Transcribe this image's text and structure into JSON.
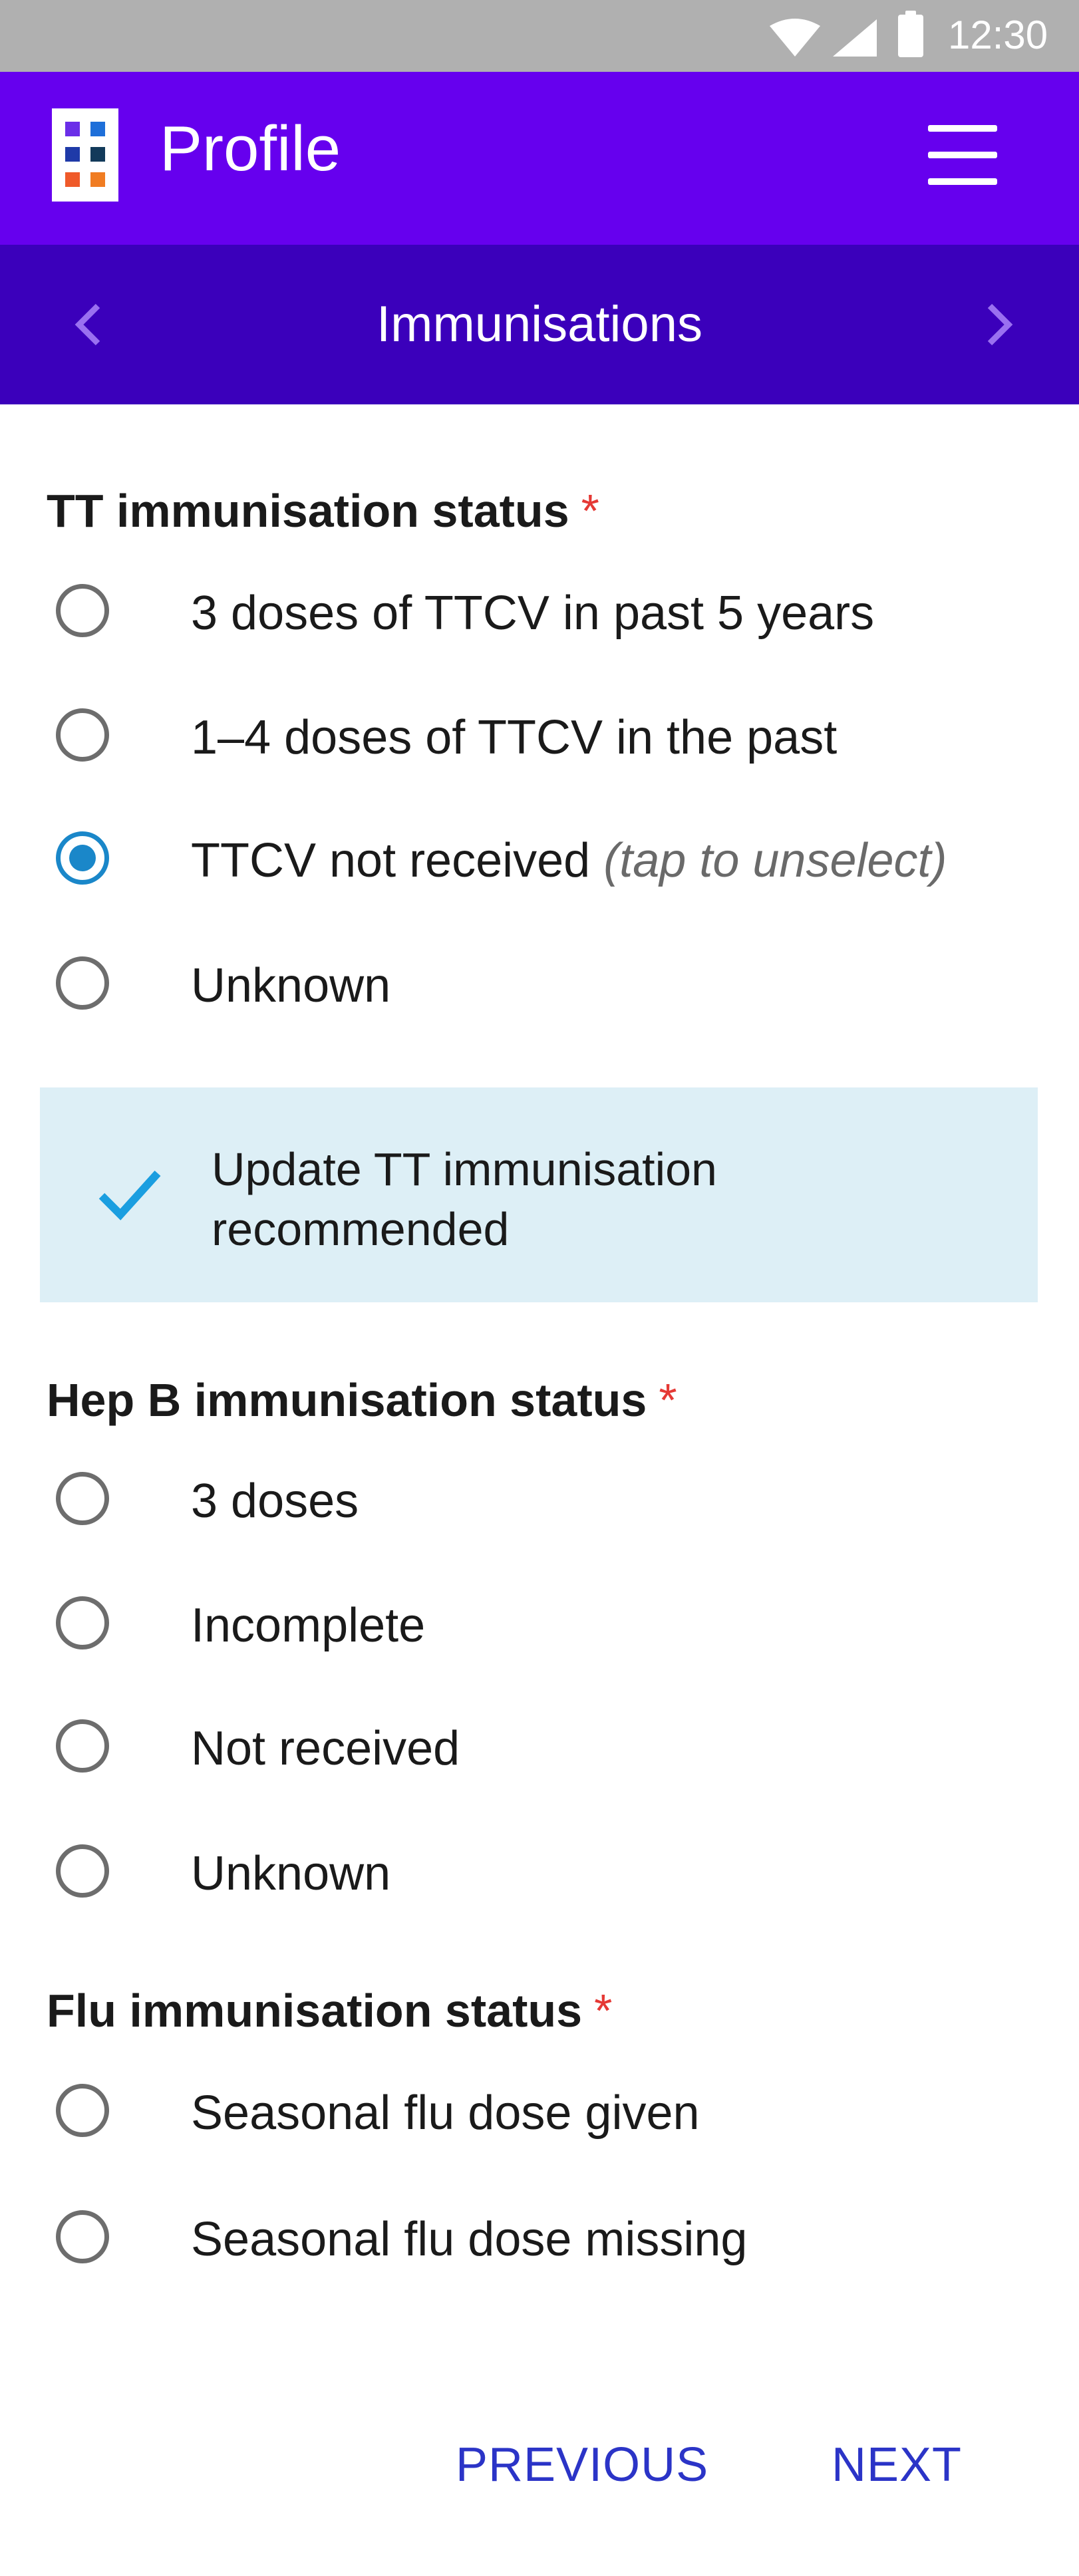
{
  "status_bar": {
    "time": "12:30",
    "icons": [
      "wifi-icon",
      "signal-icon",
      "battery-icon"
    ]
  },
  "app_bar": {
    "title": "Profile",
    "logo": "app-logo",
    "menu_icon": "menu-icon"
  },
  "sub_bar": {
    "title": "Immunisations",
    "prev_icon": "chevron-left-icon",
    "next_icon": "chevron-right-icon"
  },
  "tt": {
    "label": "TT immunisation status",
    "required": "*",
    "options": [
      {
        "label": "3 doses of TTCV in past 5 years",
        "selected": false
      },
      {
        "label": "1–4 doses of TTCV in the past",
        "selected": false
      },
      {
        "label": "TTCV not received",
        "hint": "(tap to unselect)",
        "selected": true
      },
      {
        "label": "Unknown",
        "selected": false
      }
    ]
  },
  "notice": {
    "icon": "check-icon",
    "text": "Update TT immunisation recommended"
  },
  "hepb": {
    "label": "Hep B immunisation status",
    "required": "*",
    "options": [
      {
        "label": "3 doses",
        "selected": false
      },
      {
        "label": "Incomplete",
        "selected": false
      },
      {
        "label": "Not received",
        "selected": false
      },
      {
        "label": "Unknown",
        "selected": false
      }
    ]
  },
  "flu": {
    "label": "Flu immunisation status",
    "required": "*",
    "options": [
      {
        "label": "Seasonal flu dose given",
        "selected": false
      },
      {
        "label": "Seasonal flu dose missing",
        "selected": false
      }
    ]
  },
  "footer": {
    "previous_label": "PREVIOUS",
    "next_label": "NEXT"
  },
  "colors": {
    "app_bar": "#6600ee",
    "sub_bar": "#3b00bb",
    "radio_selected": "#1a87c9",
    "required": "#e53935",
    "notice_bg": "#ddeff6",
    "button_text": "#2b34c7"
  }
}
